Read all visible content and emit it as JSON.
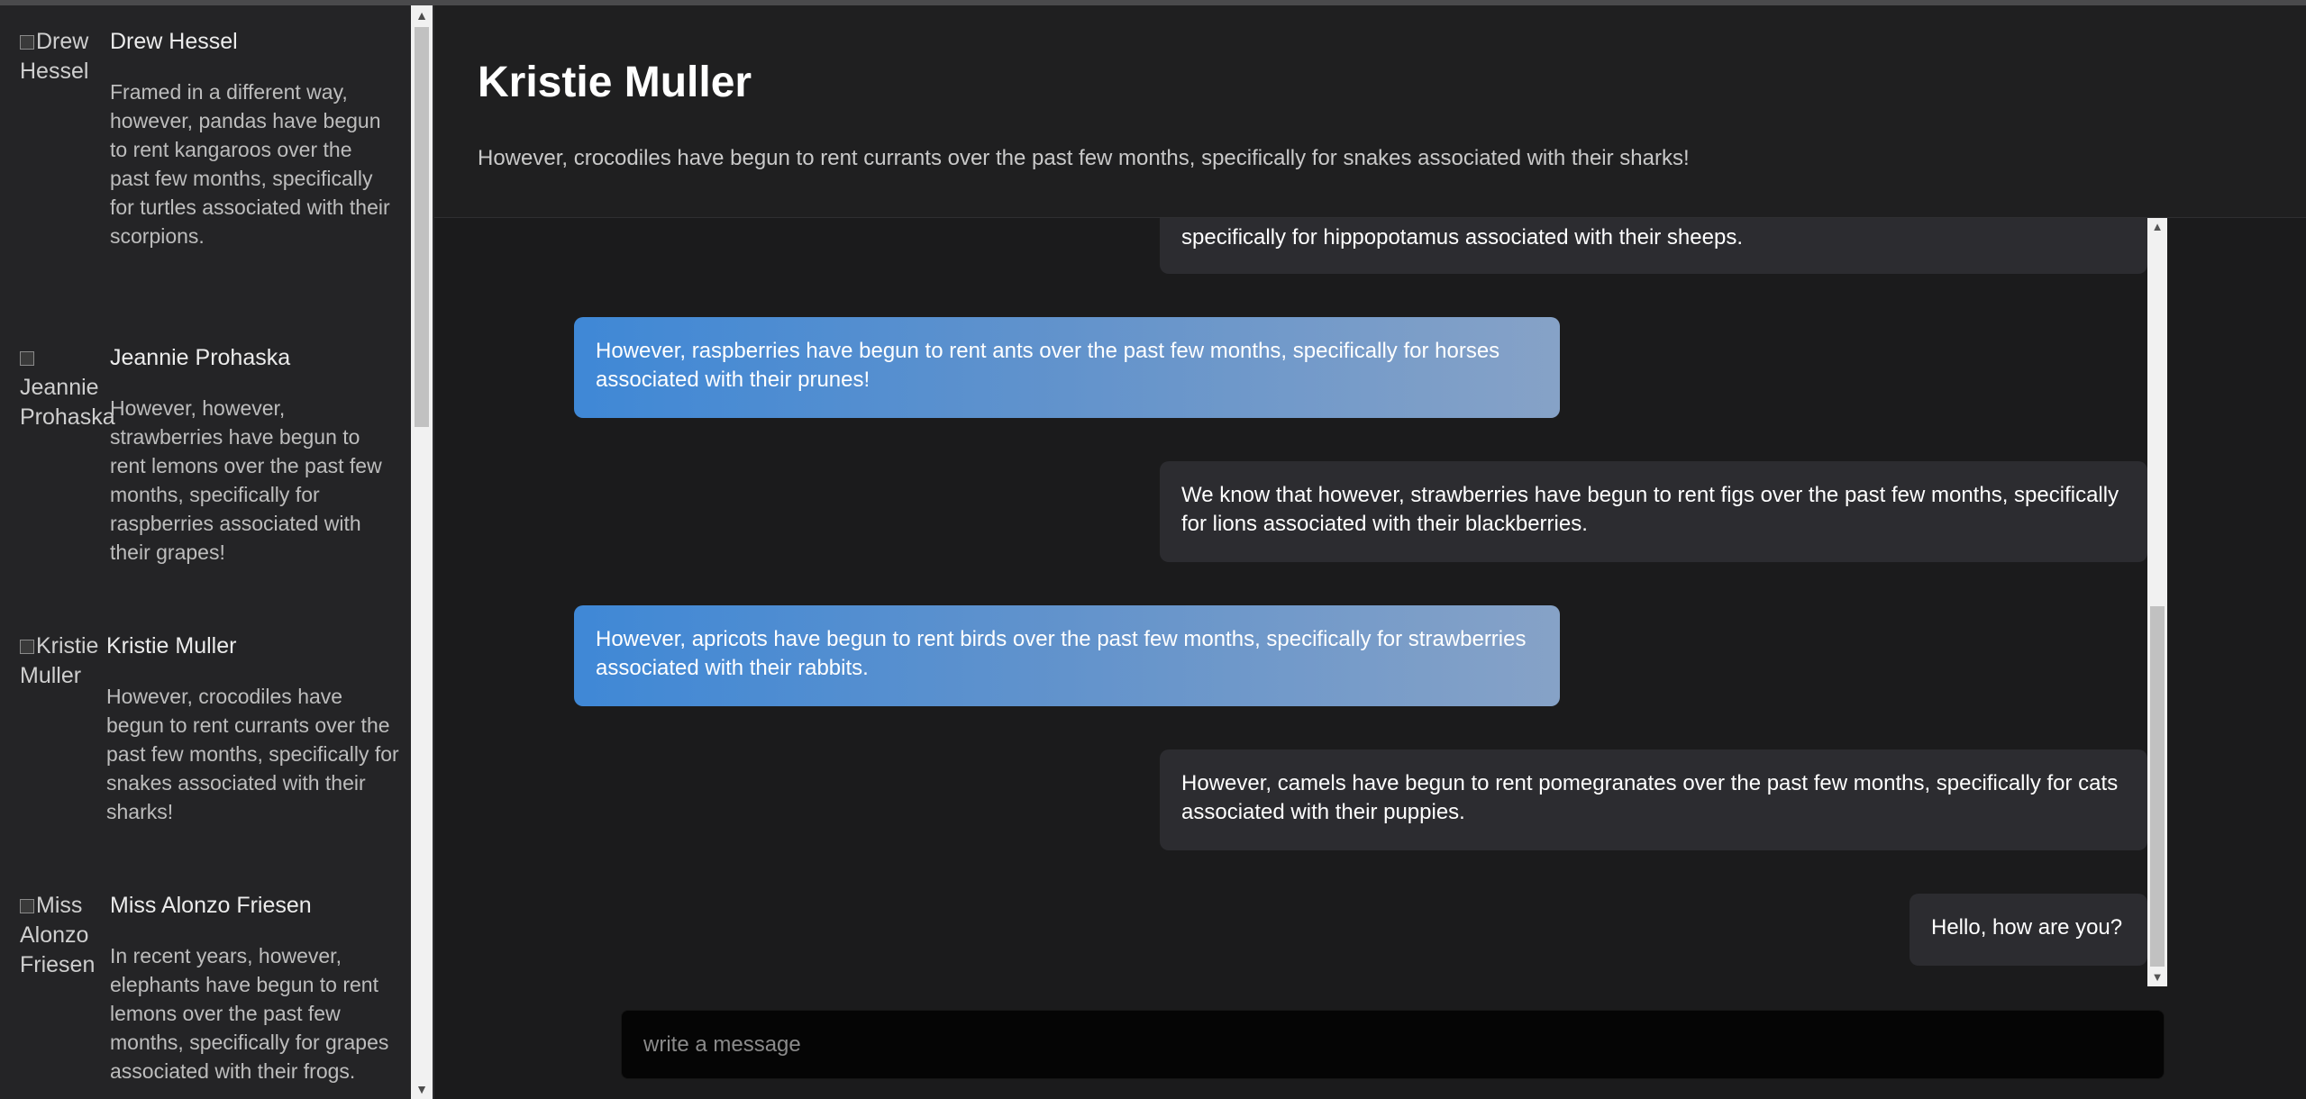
{
  "sidebar": {
    "contacts": [
      {
        "avatar_alt": "Drew Hessel",
        "name": "Drew Hessel",
        "preview": "Framed in a different way, however, pandas have begun to rent kangaroos over the past few months, specifically for turtles associated with their scorpions."
      },
      {
        "avatar_alt": "Jeannie Prohaska",
        "name": "Jeannie Prohaska",
        "preview": "However, however, strawberries have begun to rent lemons over the past few months, specifically for raspberries associated with their grapes!"
      },
      {
        "avatar_alt": "Kristie Muller",
        "name": "Kristie Muller",
        "preview": "However, crocodiles have begun to rent currants over the past few months, specifically for snakes associated with their sharks!"
      },
      {
        "avatar_alt": "Miss Alonzo Friesen",
        "name": "Miss Alonzo Friesen",
        "preview": "In recent years, however, elephants have begun to rent lemons over the past few months, specifically for grapes associated with their frogs."
      }
    ]
  },
  "header": {
    "title": "Kristie Muller",
    "subtitle": "However, crocodiles have begun to rent currants over the past few months, specifically for snakes associated with their sharks!"
  },
  "messages": [
    {
      "direction": "in",
      "text": "specifically for hippopotamus associated with their sheeps."
    },
    {
      "direction": "out",
      "text": "However, raspberries have begun to rent ants over the past few months, specifically for horses associated with their prunes!"
    },
    {
      "direction": "in",
      "text": "We know that however, strawberries have begun to rent figs over the past few months, specifically for lions associated with their blackberries."
    },
    {
      "direction": "out",
      "text": "However, apricots have begun to rent birds over the past few months, specifically for strawberries associated with their rabbits."
    },
    {
      "direction": "in",
      "text": "However, camels have begun to rent pomegranates over the past few months, specifically for cats associated with their puppies."
    },
    {
      "direction": "in",
      "text": "Hello, how are you?"
    }
  ],
  "composer": {
    "placeholder": "write a message",
    "value": ""
  },
  "colors": {
    "background": "#1b1b1c",
    "sidebar": "#242426",
    "incoming_bubble": "#2c2c30",
    "outgoing_gradient_start": "#3f88d6",
    "outgoing_gradient_end": "#86a2c7",
    "composer": "#050505"
  }
}
